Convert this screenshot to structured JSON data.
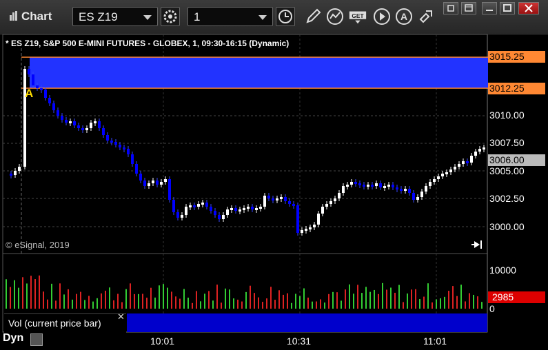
{
  "window": {
    "title": "Chart",
    "symbol": "ES Z19",
    "interval": "1"
  },
  "toolbar": {
    "icons": [
      "gear-icon",
      "clock-icon",
      "pencil-icon",
      "study-icon",
      "get-icon",
      "play-icon",
      "alert-icon",
      "link-icon"
    ],
    "window_controls": [
      "restore-icon",
      "tile-icon",
      "maximize-icon",
      "close-icon"
    ]
  },
  "chart": {
    "header": "* ES Z19, S&P 500 E-MINI FUTURES - GLOBEX, 1, 09:30-16:15 (Dynamic)",
    "watermark": "© eSignal, 2019",
    "annotation": "A",
    "price_axis": [
      "3010.00",
      "3007.50",
      "3005.00",
      "3002.50",
      "3000.00"
    ],
    "band_top": "3015.25",
    "band_bottom": "3012.25",
    "current_price": "3006.00",
    "time_axis": [
      "10:01",
      "10:31",
      "11:01"
    ],
    "colors": {
      "up": "#ffffff",
      "down": "#0000ff",
      "band": "#2233ff",
      "band_border": "#ff8833",
      "vol_up": "#33cc33",
      "vol_down": "#dd2222"
    }
  },
  "volume": {
    "label": "Vol (current price bar)",
    "axis": [
      "10000",
      "0"
    ],
    "current": "2985"
  },
  "status": {
    "mode": "Dyn"
  }
}
